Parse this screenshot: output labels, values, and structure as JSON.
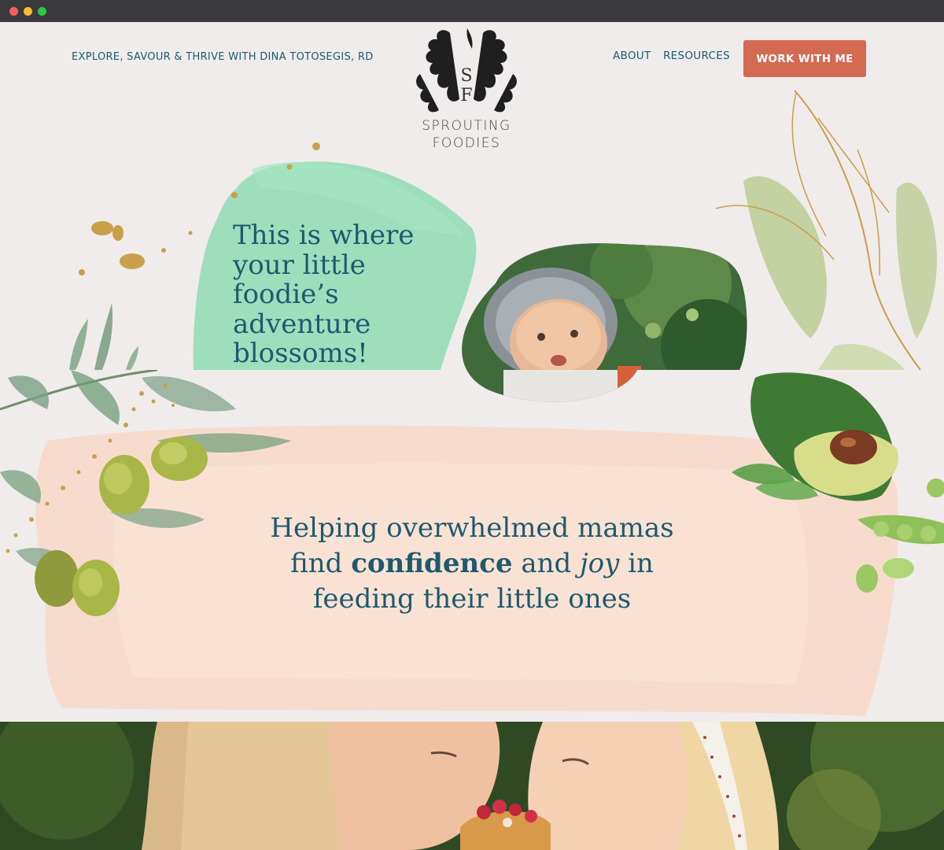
{
  "browser": {
    "controls": [
      "close",
      "minimize",
      "zoom"
    ]
  },
  "header": {
    "tagline": "EXPLORE, SAVOUR & THRIVE WITH DINA TOTOSEGIS, RD",
    "nav": {
      "about": "ABOUT",
      "resources": "RESOURCES"
    },
    "cta": "WORK WITH ME"
  },
  "logo": {
    "monogram_top": "S",
    "monogram_bottom": "F",
    "line1": "SPROUTING",
    "line2": "FOODIES"
  },
  "hero": {
    "title_lines": [
      "This is where",
      "your little",
      "foodie’s",
      "adventure",
      "blossoms!"
    ]
  },
  "mission": {
    "line1": "Helping overwhelmed mamas",
    "pre_bold": "find ",
    "bold": "confidence",
    "mid": " and ",
    "italic": "joy",
    "post": " in",
    "line3": "feeding their little ones"
  },
  "colors": {
    "teal_text": "#1e5a6e",
    "cta_bg": "#d56a52",
    "page_bg": "#f0ecec",
    "mint_wash": "#8fdcb4",
    "peach_wash": "#f7dccd",
    "gold": "#c9a04a"
  }
}
